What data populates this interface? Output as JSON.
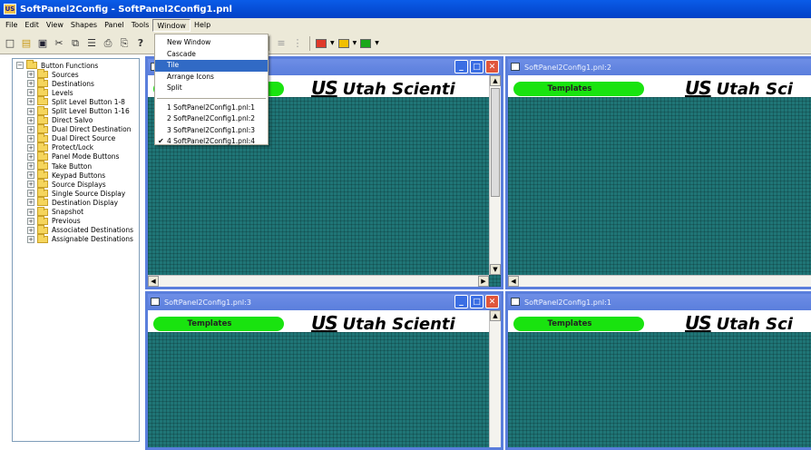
{
  "app": {
    "icon_text": "US",
    "title": "SoftPanel2Config - SoftPanel2Config1.pnl"
  },
  "menubar": [
    "File",
    "Edit",
    "View",
    "Shapes",
    "Panel",
    "Tools",
    "Window",
    "Help"
  ],
  "window_menu": {
    "items_top": [
      "New Window",
      "Cascade",
      "Tile",
      "Arrange Icons",
      "Split"
    ],
    "highlighted": "Tile",
    "items_windows": [
      "1 SoftPanel2Config1.pnl:1",
      "2 SoftPanel2Config1.pnl:2",
      "3 SoftPanel2Config1.pnl:3",
      "4 SoftPanel2Config1.pnl:4"
    ],
    "checked": "4 SoftPanel2Config1.pnl:4"
  },
  "toolbar": {
    "icons": [
      "new-icon",
      "open-icon",
      "save-icon",
      "cut-icon",
      "copy-icon",
      "paste-icon",
      "print-icon",
      "print-preview-icon",
      "help-icon"
    ],
    "colors": [
      "#e03a2a",
      "#f2c000",
      "#1aa81a"
    ]
  },
  "tree": {
    "root": "Button Functions",
    "children": [
      "Sources",
      "Destinations",
      "Levels",
      "Split Level Button 1-8",
      "Split Level Button 1-16",
      "Direct Salvo",
      "Dual Direct Destination",
      "Dual Direct Source",
      "Protect/Lock",
      "Panel Mode Buttons",
      "Take Button",
      "Keypad Buttons",
      "Source Displays",
      "Single Source Display",
      "Destination Display",
      "Snapshot",
      "Previous",
      "Associated Destinations",
      "Assignable Destinations"
    ]
  },
  "windows": {
    "w4": {
      "title": "",
      "template_label": "",
      "logo": "Utah Scienti"
    },
    "w2": {
      "title": "SoftPanel2Config1.pnl:2",
      "template_label": "Templates",
      "logo": "Utah Sci"
    },
    "w3": {
      "title": "SoftPanel2Config1.pnl:3",
      "template_label": "Templates",
      "logo": "Utah Scienti"
    },
    "w1": {
      "title": "SoftPanel2Config1.pnl:1",
      "template_label": "Templates",
      "logo": "Utah Sci"
    },
    "logo_mark": "US"
  },
  "colors": {
    "title_blue": "#0a5ce8",
    "canvas_teal": "#1f7576",
    "template_green": "#19e30f",
    "menu_highlight": "#316ac5"
  }
}
